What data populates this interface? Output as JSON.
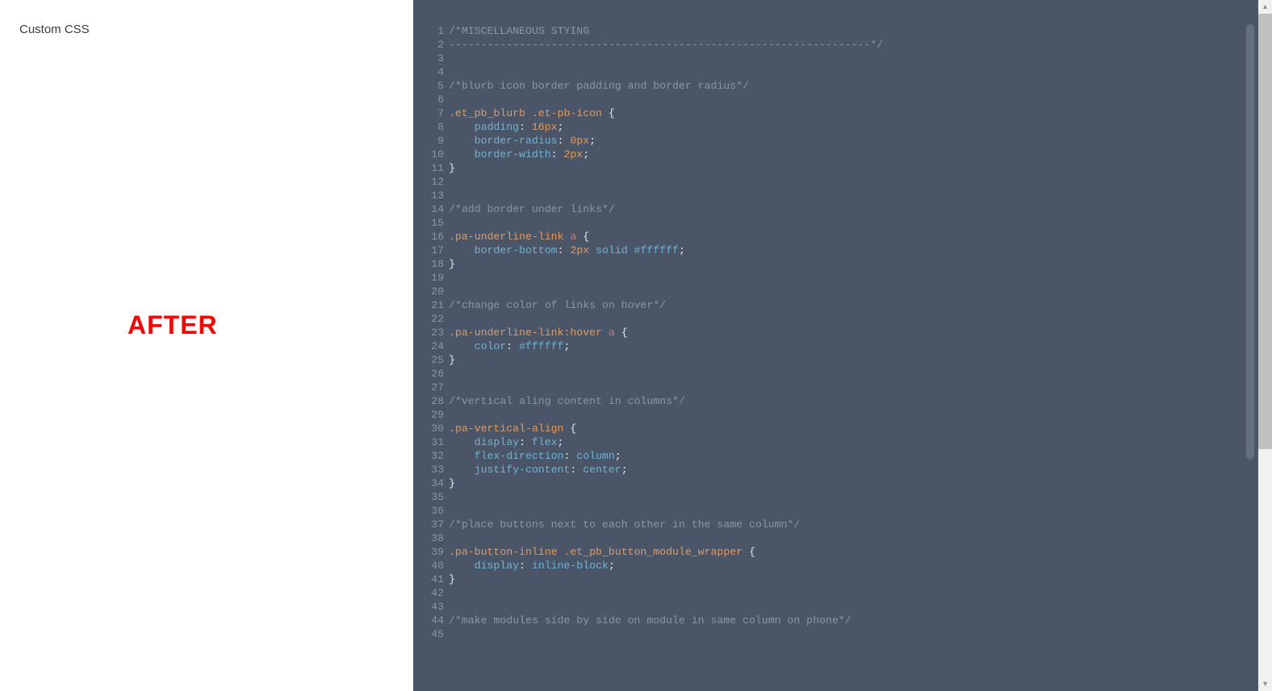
{
  "left": {
    "section_label": "Custom CSS",
    "overlay_text": "AFTER"
  },
  "editor": {
    "lines": [
      {
        "n": "1",
        "tokens": [
          {
            "c": "cm-comment",
            "t": "/*MISCELLANEOUS STYING"
          }
        ]
      },
      {
        "n": "2",
        "tokens": [
          {
            "c": "cm-comment",
            "t": "------------------------------------------------------------------*/"
          }
        ]
      },
      {
        "n": "3",
        "tokens": []
      },
      {
        "n": "4",
        "tokens": []
      },
      {
        "n": "5",
        "tokens": [
          {
            "c": "cm-comment",
            "t": "/*blurb icon border padding and border radius*/"
          }
        ]
      },
      {
        "n": "6",
        "tokens": []
      },
      {
        "n": "7",
        "tokens": [
          {
            "c": "cm-selector",
            "t": ".et_pb_blurb"
          },
          {
            "c": "cm-brace",
            "t": " "
          },
          {
            "c": "cm-selector",
            "t": ".et-pb-icon"
          },
          {
            "c": "cm-brace",
            "t": " {"
          }
        ]
      },
      {
        "n": "8",
        "tokens": [
          {
            "c": "cm-brace",
            "t": "    "
          },
          {
            "c": "cm-prop",
            "t": "padding"
          },
          {
            "c": "cm-punct",
            "t": ": "
          },
          {
            "c": "cm-num",
            "t": "16px"
          },
          {
            "c": "cm-punct",
            "t": ";"
          }
        ]
      },
      {
        "n": "9",
        "tokens": [
          {
            "c": "cm-brace",
            "t": "    "
          },
          {
            "c": "cm-prop",
            "t": "border-radius"
          },
          {
            "c": "cm-punct",
            "t": ": "
          },
          {
            "c": "cm-num",
            "t": "0px"
          },
          {
            "c": "cm-punct",
            "t": ";"
          }
        ]
      },
      {
        "n": "10",
        "tokens": [
          {
            "c": "cm-brace",
            "t": "    "
          },
          {
            "c": "cm-prop",
            "t": "border-width"
          },
          {
            "c": "cm-punct",
            "t": ": "
          },
          {
            "c": "cm-num",
            "t": "2px"
          },
          {
            "c": "cm-punct",
            "t": ";"
          }
        ]
      },
      {
        "n": "11",
        "tokens": [
          {
            "c": "cm-brace",
            "t": "}"
          }
        ]
      },
      {
        "n": "12",
        "tokens": []
      },
      {
        "n": "13",
        "tokens": []
      },
      {
        "n": "14",
        "tokens": [
          {
            "c": "cm-comment",
            "t": "/*add border under links*/"
          }
        ]
      },
      {
        "n": "15",
        "tokens": []
      },
      {
        "n": "16",
        "tokens": [
          {
            "c": "cm-selector",
            "t": ".pa-underline-link"
          },
          {
            "c": "cm-brace",
            "t": " "
          },
          {
            "c": "cm-tag",
            "t": "a"
          },
          {
            "c": "cm-brace",
            "t": " {"
          }
        ]
      },
      {
        "n": "17",
        "tokens": [
          {
            "c": "cm-brace",
            "t": "    "
          },
          {
            "c": "cm-prop",
            "t": "border-bottom"
          },
          {
            "c": "cm-punct",
            "t": ": "
          },
          {
            "c": "cm-num",
            "t": "2px"
          },
          {
            "c": "cm-brace",
            "t": " "
          },
          {
            "c": "cm-keyword",
            "t": "solid"
          },
          {
            "c": "cm-brace",
            "t": " "
          },
          {
            "c": "cm-hex",
            "t": "#ffffff"
          },
          {
            "c": "cm-punct",
            "t": ";"
          }
        ]
      },
      {
        "n": "18",
        "tokens": [
          {
            "c": "cm-brace",
            "t": "}"
          }
        ]
      },
      {
        "n": "19",
        "tokens": []
      },
      {
        "n": "20",
        "tokens": []
      },
      {
        "n": "21",
        "tokens": [
          {
            "c": "cm-comment",
            "t": "/*change color of links on hover*/"
          }
        ]
      },
      {
        "n": "22",
        "tokens": []
      },
      {
        "n": "23",
        "tokens": [
          {
            "c": "cm-selector",
            "t": ".pa-underline-link:hover"
          },
          {
            "c": "cm-brace",
            "t": " "
          },
          {
            "c": "cm-tag",
            "t": "a"
          },
          {
            "c": "cm-brace",
            "t": " {"
          }
        ]
      },
      {
        "n": "24",
        "tokens": [
          {
            "c": "cm-brace",
            "t": "    "
          },
          {
            "c": "cm-prop",
            "t": "color"
          },
          {
            "c": "cm-punct",
            "t": ": "
          },
          {
            "c": "cm-hex",
            "t": "#ffffff"
          },
          {
            "c": "cm-punct",
            "t": ";"
          }
        ]
      },
      {
        "n": "25",
        "tokens": [
          {
            "c": "cm-brace",
            "t": "}"
          }
        ]
      },
      {
        "n": "26",
        "tokens": []
      },
      {
        "n": "27",
        "tokens": []
      },
      {
        "n": "28",
        "tokens": [
          {
            "c": "cm-comment",
            "t": "/*vertical aling content in columns*/"
          }
        ]
      },
      {
        "n": "29",
        "tokens": []
      },
      {
        "n": "30",
        "tokens": [
          {
            "c": "cm-selector",
            "t": ".pa-vertical-align"
          },
          {
            "c": "cm-brace",
            "t": " {"
          }
        ]
      },
      {
        "n": "31",
        "tokens": [
          {
            "c": "cm-brace",
            "t": "    "
          },
          {
            "c": "cm-prop",
            "t": "display"
          },
          {
            "c": "cm-punct",
            "t": ": "
          },
          {
            "c": "cm-keyword",
            "t": "flex"
          },
          {
            "c": "cm-punct",
            "t": ";"
          }
        ]
      },
      {
        "n": "32",
        "tokens": [
          {
            "c": "cm-brace",
            "t": "    "
          },
          {
            "c": "cm-prop",
            "t": "flex-direction"
          },
          {
            "c": "cm-punct",
            "t": ": "
          },
          {
            "c": "cm-keyword",
            "t": "column"
          },
          {
            "c": "cm-punct",
            "t": ";"
          }
        ]
      },
      {
        "n": "33",
        "tokens": [
          {
            "c": "cm-brace",
            "t": "    "
          },
          {
            "c": "cm-prop",
            "t": "justify-content"
          },
          {
            "c": "cm-punct",
            "t": ": "
          },
          {
            "c": "cm-keyword",
            "t": "center"
          },
          {
            "c": "cm-punct",
            "t": ";"
          }
        ]
      },
      {
        "n": "34",
        "tokens": [
          {
            "c": "cm-brace",
            "t": "}"
          }
        ]
      },
      {
        "n": "35",
        "tokens": []
      },
      {
        "n": "36",
        "tokens": []
      },
      {
        "n": "37",
        "tokens": [
          {
            "c": "cm-comment",
            "t": "/*place buttons next to each other in the same column*/"
          }
        ]
      },
      {
        "n": "38",
        "tokens": []
      },
      {
        "n": "39",
        "tokens": [
          {
            "c": "cm-selector",
            "t": ".pa-button-inline"
          },
          {
            "c": "cm-brace",
            "t": " "
          },
          {
            "c": "cm-selector",
            "t": ".et_pb_button_module_wrapper"
          },
          {
            "c": "cm-brace",
            "t": " {"
          }
        ]
      },
      {
        "n": "40",
        "tokens": [
          {
            "c": "cm-brace",
            "t": "    "
          },
          {
            "c": "cm-prop",
            "t": "display"
          },
          {
            "c": "cm-punct",
            "t": ": "
          },
          {
            "c": "cm-keyword",
            "t": "inline-block"
          },
          {
            "c": "cm-punct",
            "t": ";"
          }
        ]
      },
      {
        "n": "41",
        "tokens": [
          {
            "c": "cm-brace",
            "t": "}"
          }
        ]
      },
      {
        "n": "42",
        "tokens": []
      },
      {
        "n": "43",
        "tokens": []
      },
      {
        "n": "44",
        "tokens": [
          {
            "c": "cm-comment",
            "t": "/*make modules side by side on module in same column on phone*/"
          }
        ]
      },
      {
        "n": "45",
        "tokens": []
      }
    ]
  },
  "scroll": {
    "up_glyph": "▴",
    "down_glyph": "▾"
  }
}
